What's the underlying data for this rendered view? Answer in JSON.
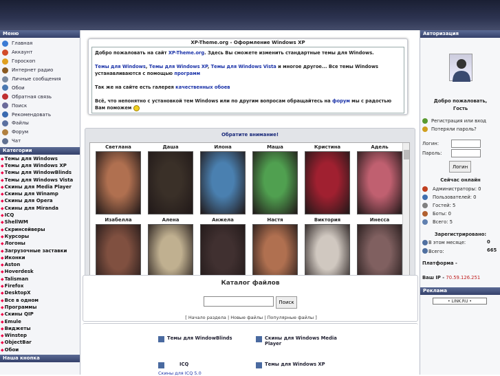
{
  "left": {
    "menu_title": "Меню",
    "menu": [
      {
        "label": "Главная",
        "icon": "globe-icon",
        "color": "#3b7bd4"
      },
      {
        "label": "Аккаунт",
        "icon": "user-icon",
        "color": "#d24b2a"
      },
      {
        "label": "Гороскоп",
        "icon": "star-icon",
        "color": "#e0a020"
      },
      {
        "label": "Интернет радио",
        "icon": "radio-icon",
        "color": "#8a5a20"
      },
      {
        "label": "Личные сообщения",
        "icon": "mail-icon",
        "color": "#7a8aa0"
      },
      {
        "label": "Обои",
        "icon": "image-icon",
        "color": "#4a78b0"
      },
      {
        "label": "Обратная связь",
        "icon": "feedback-icon",
        "color": "#c03030"
      },
      {
        "label": "Поиск",
        "icon": "search-icon",
        "color": "#6a6a9a"
      },
      {
        "label": "Рекомендовать",
        "icon": "recommend-icon",
        "color": "#3a6ab0"
      },
      {
        "label": "Файлы",
        "icon": "files-icon",
        "color": "#5a70a0"
      },
      {
        "label": "Форум",
        "icon": "forum-icon",
        "color": "#b08040"
      },
      {
        "label": "Чат",
        "icon": "chat-icon",
        "color": "#607090"
      }
    ],
    "categories_title": "Категории",
    "categories": [
      "Темы для Windows",
      "Темы для Windows XP",
      "Темы для WindowBlinds",
      "Темы для Windows Vista",
      "Скины для Media Player",
      "Скины для Winamp",
      "Скины для Opera",
      "Скины для Miranda",
      "ICQ",
      "ShellWM",
      "Скринсейверы",
      "Курсоры",
      "Логоны",
      "Загрузочные заставки",
      "Иконки",
      "Aston",
      "Hoverdesk",
      "Talisman",
      "Firefox",
      "DesktopX",
      "Все в одном",
      "Программы",
      "Скины QIP",
      "Emule",
      "Виджеты",
      "Winstep",
      "ObjectBar",
      "Обои"
    ],
    "button_title": "Наша кнопка"
  },
  "welcome": {
    "title": "XP-Theme.org - Оформление Windows XP",
    "p1a": "Добро пожаловать на сайт ",
    "p1link": "XP-Theme.org",
    "p1b": ". Здесь Вы сможете изменить стандартные темы для Windows.",
    "p2link1": "Темы для Windows",
    "p2link2": "Темы для Windows XP",
    "p2link3": "Темы для Windows Vista",
    "p2a": " и многое другое... Все темы Windows устанавливаются с помощью ",
    "p2link4": "программ",
    "p3a": "Так же на сайте есть галерея ",
    "p3link": "качественных обоев",
    "p4a": "Всё, что непонятно с установкой тем Windows или по другим вопросам обращайтесь на ",
    "p4link": "форум",
    "p4b": " мы с радостью Вам поможем"
  },
  "notice": {
    "title": "Обратите внимание!",
    "names_row1": [
      "Светлана",
      "Даша",
      "Илона",
      "Маша",
      "Кристина",
      "Адель"
    ],
    "names_row2": [
      "Изабелла",
      "Алена",
      "Анжела",
      "Настя",
      "Виктория",
      "Инесса"
    ],
    "photo_colors_row1": [
      "#b07050",
      "#3a3028",
      "#4a80b0",
      "#50a050",
      "#a02030",
      "#c06070"
    ],
    "photo_colors_row2": [
      "#805040",
      "#c0b090",
      "#403030",
      "#b07050",
      "#d0c8c0",
      "#806060"
    ]
  },
  "catalog": {
    "title": "Каталог файлов",
    "search_button": "Поиск",
    "link1": "Начало раздела",
    "link2": "Новые файлы",
    "link3": "Популярные файлы"
  },
  "files": [
    {
      "label": "Темы для WindowBlinds"
    },
    {
      "label": "Скины для Windows Media Player"
    },
    {
      "label": "ICQ"
    },
    {
      "label": "Темы для Windows XP"
    }
  ],
  "files_sub": "Скины для ICQ 5.0",
  "right": {
    "auth_title": "Авторизация",
    "greeting1": "Добро пожаловать,",
    "greeting2": "Гость",
    "register": "Регистрация или вход",
    "lost_password": "Потеряли пароль?",
    "login_label": "Логин:",
    "password_label": "Пароль:",
    "login_button": "Логин",
    "online_title": "Сейчас онлайн",
    "admins": "Администраторы: 0",
    "users": "Пользователей: 0",
    "guests": "Гостей: 5",
    "bots": "Боты: 0",
    "total": "Всего: 5",
    "registered_title": "Зарегистрировано:",
    "this_month_label": "В этом месяце:",
    "this_month_value": "0",
    "total_label": "Всего:",
    "total_value": "665",
    "platform": "Платформа -",
    "ip_label": "Ваш IP - ",
    "ip_value": "70.59.126.251",
    "ads_title": "Реклама",
    "ad_text": "• LINK.RU •"
  }
}
